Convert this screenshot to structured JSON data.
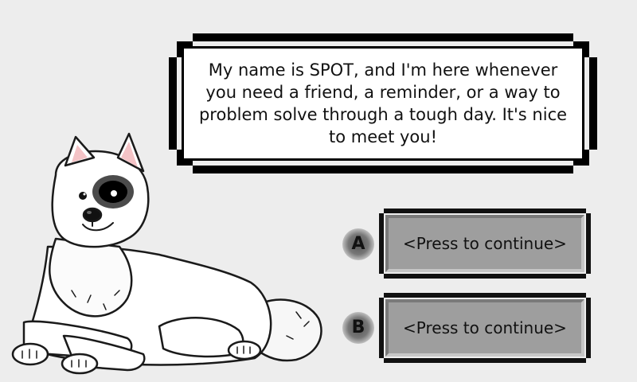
{
  "dialog": {
    "text": "My name is SPOT, and I'm here whenever you need a friend, a reminder, or a way to problem solve through a tough day. It's nice to meet you!"
  },
  "choices": [
    {
      "letter": "A",
      "label": "<Press to continue>"
    },
    {
      "letter": "B",
      "label": "<Press to continue>"
    }
  ],
  "character": {
    "icon": "white-dog-character-spot"
  },
  "colors": {
    "background": "#ededed",
    "button_face": "#9e9e9e",
    "border": "#000000"
  }
}
